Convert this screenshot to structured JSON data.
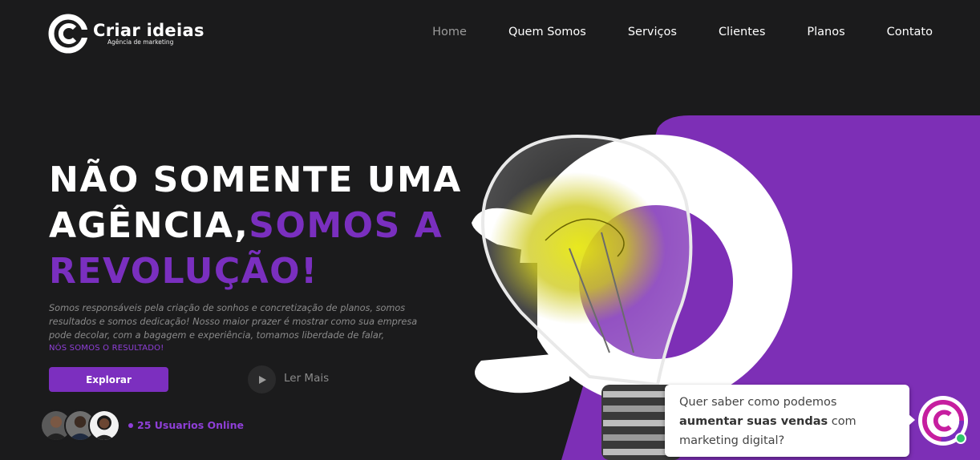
{
  "brand": {
    "name": "Criar ideias",
    "tagline": "Agência de marketing"
  },
  "nav": {
    "items": [
      "Home",
      "Quem Somos",
      "Serviços",
      "Clientes",
      "Planos",
      "Contato"
    ],
    "active": "Home"
  },
  "hero": {
    "headline_line1": "NÃO SOMENTE UMA",
    "headline_line2_white": "AGÊNCIA,",
    "headline_line2_purple": "SOMOS A",
    "headline_line3": "REVOLUÇÃO!",
    "description": "Somos responsáveis pela criação de sonhos e concretização de planos, somos resultados e somos dedicação! Nosso maior prazer é mostrar como sua empresa pode decolar, com a bagagem e experiência, tomamos liberdade de falar,",
    "result_line": "NÓS SOMOS O RESULTADO!",
    "explore_label": "Explorar",
    "read_more_label": "Ler Mais",
    "online_text": "25 Usuarios Online"
  },
  "chat": {
    "text_before": "Quer saber como podemos",
    "text_bold": "aumentar suas vendas",
    "text_after": "com marketing digital?"
  },
  "colors": {
    "background": "#1b1b1c",
    "accent_purple": "#7c2fbf",
    "online_green": "#2fc66b"
  },
  "icons": [
    "logo-icon",
    "play-icon",
    "avatar-icon",
    "chat-logo-icon",
    "lightbulb-illustration"
  ]
}
